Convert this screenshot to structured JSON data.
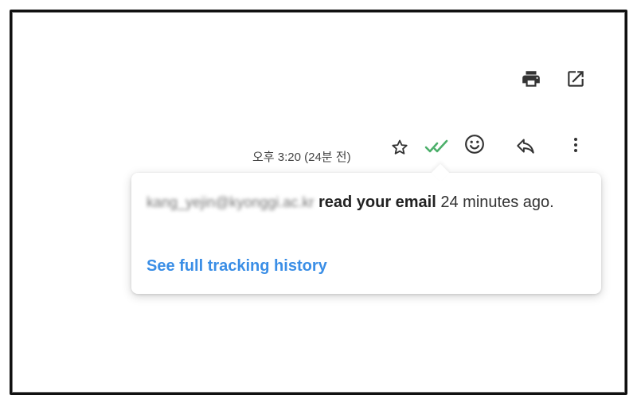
{
  "toolbar": {
    "print_icon": "printer-icon",
    "open_new_window_icon": "open-in-new-icon"
  },
  "message_header": {
    "timestamp": "오후 3:20 (24분 전)",
    "icons": [
      "star-icon",
      "double-check-icon",
      "emoji-icon",
      "reply-icon",
      "more-vert-icon"
    ]
  },
  "tracking_popup": {
    "email": "kang_yejin@kyonggi.ac.kr",
    "read_text": "read your email",
    "time_text": "24 minutes ago.",
    "link_label": "See full tracking history"
  },
  "colors": {
    "check_green": "#4caf6a",
    "link_blue": "#3a8ee6",
    "icon_gray": "#333333"
  }
}
